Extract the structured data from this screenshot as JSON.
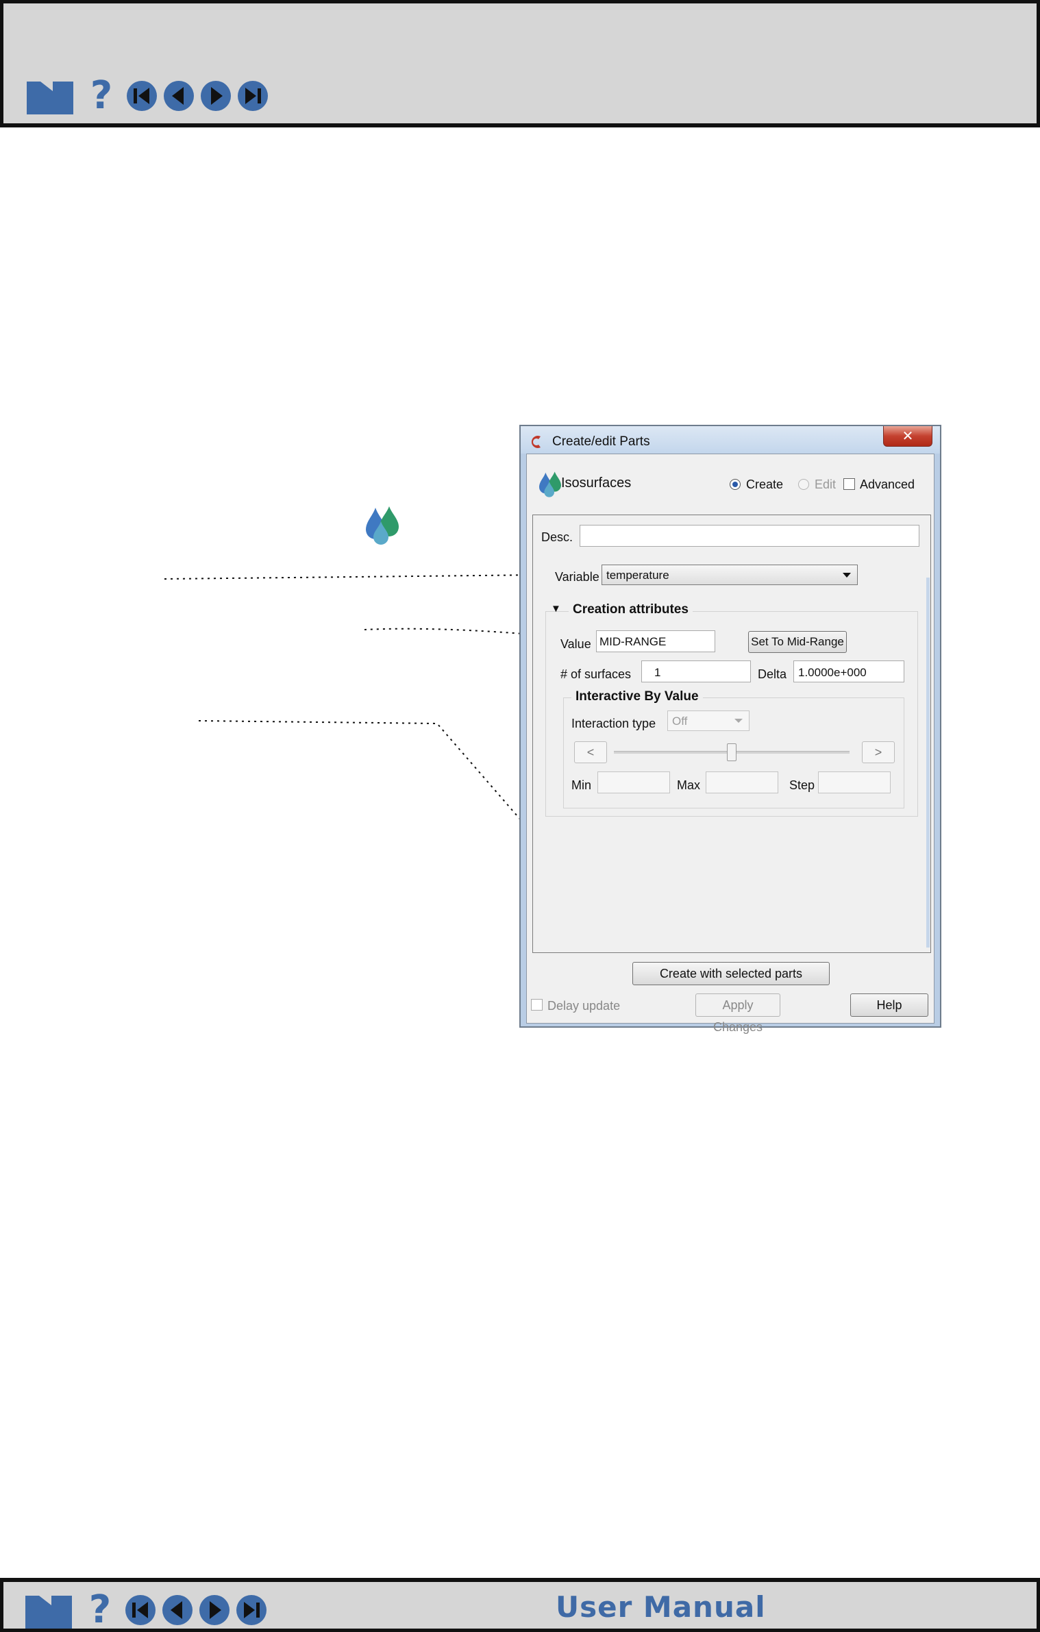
{
  "nav": {
    "icons": [
      "home-icon",
      "help-icon",
      "first-page-icon",
      "previous-page-icon",
      "next-page-icon",
      "last-page-icon"
    ],
    "help_glyph": "?",
    "footer_title": "User Manual",
    "colors": {
      "bar": "#d6d6d6",
      "icon": "#3e6ba8",
      "border": "#111111"
    }
  },
  "dialog": {
    "title": "Create/edit Parts",
    "close_glyph": "✕",
    "header_label": "Isosurfaces",
    "mode": {
      "create_label": "Create",
      "edit_label": "Edit",
      "advanced_label": "Advanced",
      "selected": "Create"
    },
    "desc_label": "Desc.",
    "desc_value": "",
    "variable_label": "Variable",
    "variable_value": "temperature",
    "creation": {
      "toggle_glyph": "▼",
      "title": "Creation attributes",
      "value_label": "Value",
      "value_value": "MID-RANGE",
      "set_mid_range_label": "Set To Mid-Range",
      "surfaces_label": "# of surfaces",
      "surfaces_value": "1",
      "delta_label": "Delta",
      "delta_value": "1.0000e+000"
    },
    "interactive": {
      "title": "Interactive By Value",
      "interaction_type_label": "Interaction type",
      "interaction_type_value": "Off",
      "prev_glyph": "<",
      "next_glyph": ">",
      "slider_position": 0.5,
      "min_label": "Min",
      "max_label": "Max",
      "step_label": "Step"
    },
    "create_button": "Create with selected parts",
    "delay_update_label": "Delay update",
    "apply_changes_label": "Apply Changes",
    "help_label": "Help"
  }
}
